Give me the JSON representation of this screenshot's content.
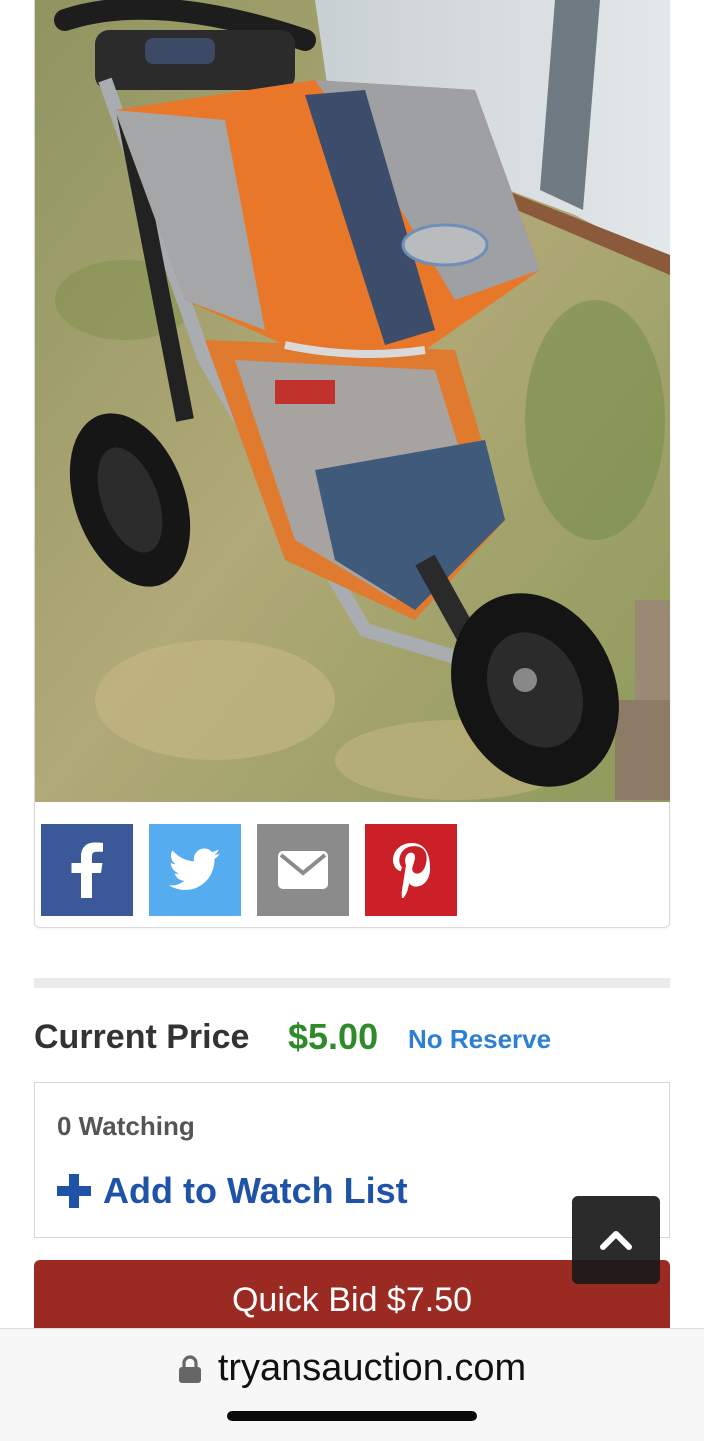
{
  "listing": {
    "photo_alt": "jogging stroller photo"
  },
  "share": {
    "items": [
      {
        "name": "facebook",
        "icon": "facebook-icon",
        "color": "#3b5998"
      },
      {
        "name": "twitter",
        "icon": "twitter-icon",
        "color": "#55acee"
      },
      {
        "name": "email",
        "icon": "mail-icon",
        "color": "#8b8b8b"
      },
      {
        "name": "pinterest",
        "icon": "pinterest-icon",
        "color": "#cb2027"
      }
    ]
  },
  "price": {
    "label": "Current Price",
    "value": "$5.00",
    "reserve": "No Reserve",
    "value_color": "#2f8a2a",
    "reserve_color": "#2d7fd3"
  },
  "watch": {
    "count_text": "0 Watching",
    "add_label": "Add to Watch List",
    "icon": "plus-icon"
  },
  "bid": {
    "label": "Quick Bid $7.50",
    "color": "#9b2a22"
  },
  "scroll_top": {
    "icon": "chevron-up-icon"
  },
  "browser": {
    "url": "tryansauction.com",
    "icon": "lock-icon"
  }
}
